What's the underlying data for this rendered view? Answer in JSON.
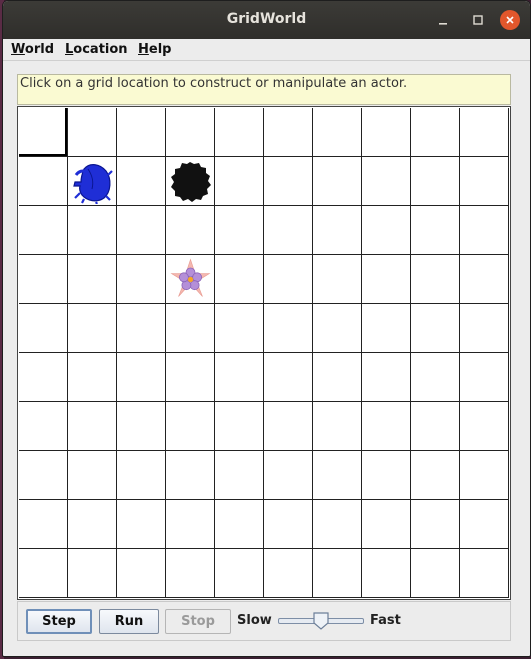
{
  "window": {
    "title": "GridWorld"
  },
  "menubar": {
    "items": [
      "World",
      "Location",
      "Help"
    ]
  },
  "message": "Click on a grid location to construct or manipulate an actor.",
  "grid": {
    "rows": 10,
    "cols": 10,
    "selected": {
      "row": 0,
      "col": 0
    },
    "actors": [
      {
        "type": "bug",
        "icon": "bug-icon",
        "row": 1,
        "col": 1,
        "color": "#1f2ed6"
      },
      {
        "type": "rock",
        "icon": "rock-icon",
        "row": 1,
        "col": 3,
        "color": "#111111"
      },
      {
        "type": "flower",
        "icon": "flower-icon",
        "row": 3,
        "col": 3,
        "color": "#b48fd8"
      }
    ]
  },
  "controls": {
    "step": "Step",
    "run": "Run",
    "stop": "Stop",
    "slow": "Slow",
    "fast": "Fast",
    "speed": 0.5
  }
}
